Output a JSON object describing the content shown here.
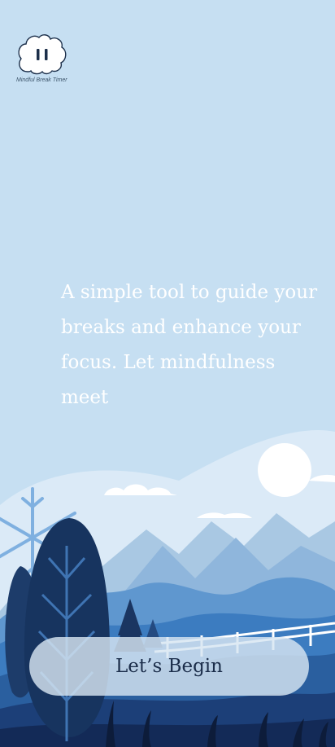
{
  "app": {
    "logo_icon": "brain-pause-icon",
    "logo_caption": "Mindful Break Timer"
  },
  "intro": {
    "tagline": "A simple tool to guide your breaks and enhance your focus. Let mindfulness meet"
  },
  "actions": {
    "begin_label": "Let’s Begin"
  },
  "colors": {
    "background": "#c6dff2",
    "button_text": "#1b2d4a",
    "accent_dark": "#1c3a6b"
  }
}
